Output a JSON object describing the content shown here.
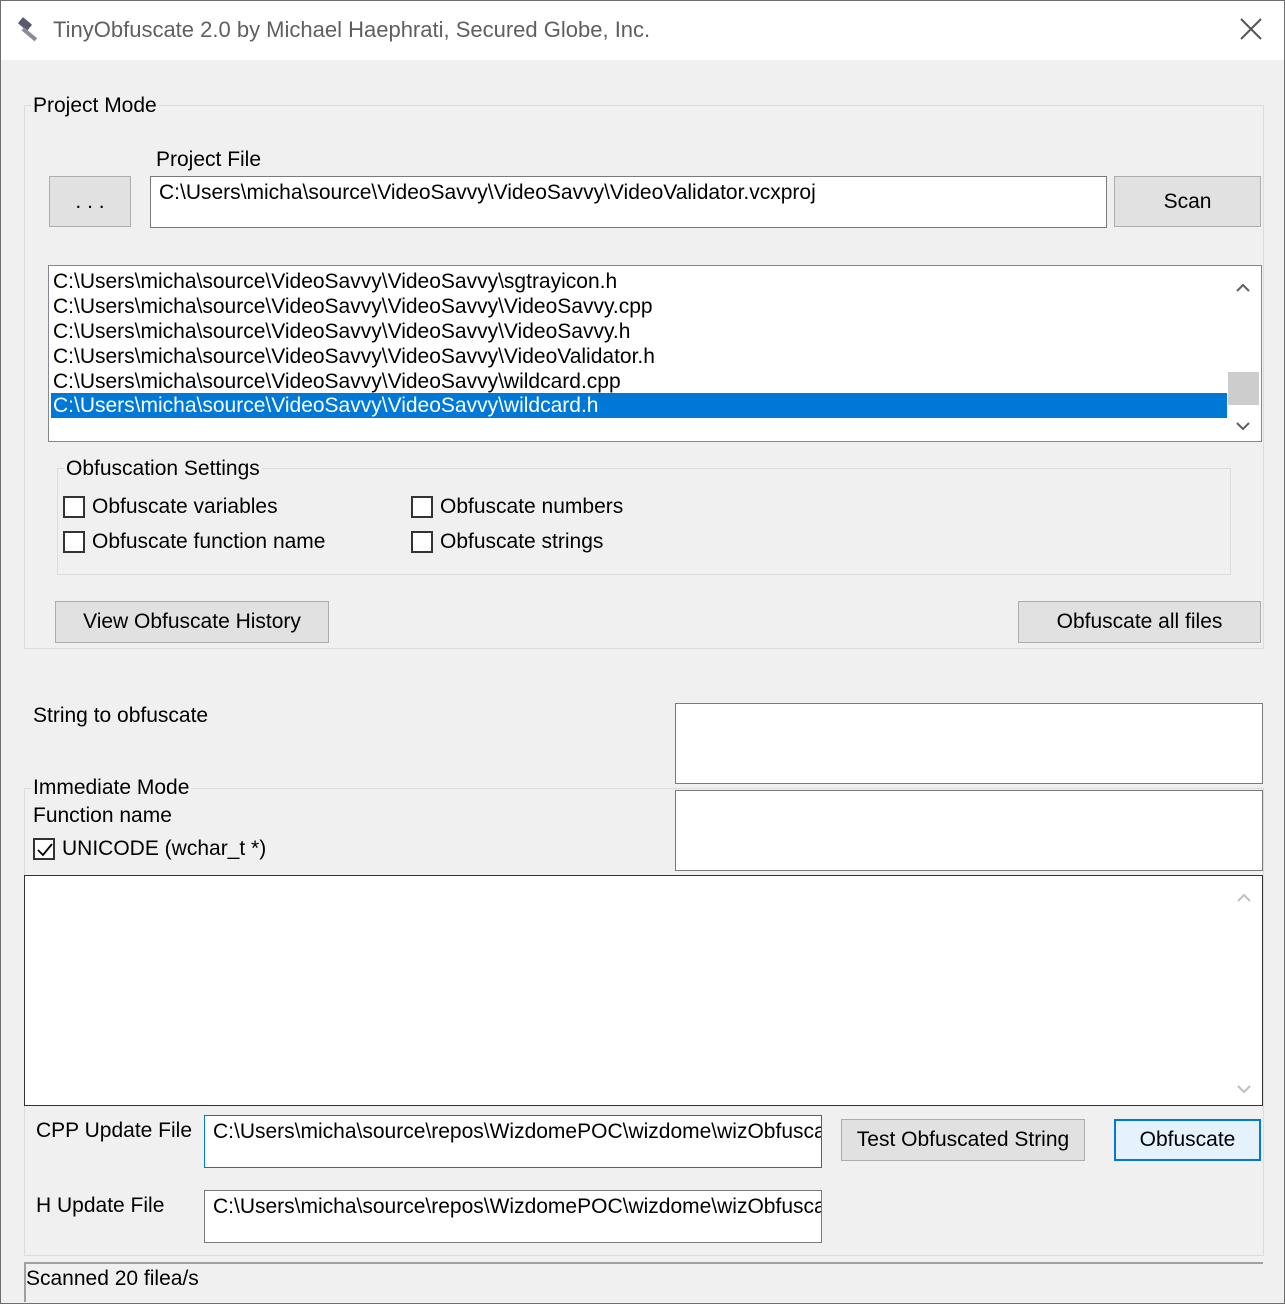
{
  "window": {
    "title": "TinyObfuscate 2.0 by Michael Haephrati, Secured Globe, Inc."
  },
  "project_mode": {
    "group_label": "Project  Mode",
    "project_file_label": "Project File",
    "browse_label": ". . .",
    "project_file_value": "C:\\Users\\micha\\source\\VideoSavvy\\VideoSavvy\\VideoValidator.vcxproj",
    "scan_label": "Scan",
    "files": [
      "C:\\Users\\micha\\source\\VideoSavvy\\VideoSavvy\\sgtrayicon.h",
      "C:\\Users\\micha\\source\\VideoSavvy\\VideoSavvy\\VideoSavvy.cpp",
      "C:\\Users\\micha\\source\\VideoSavvy\\VideoSavvy\\VideoSavvy.h",
      "C:\\Users\\micha\\source\\VideoSavvy\\VideoSavvy\\VideoValidator.h",
      "C:\\Users\\micha\\source\\VideoSavvy\\VideoSavvy\\wildcard.cpp",
      "C:\\Users\\micha\\source\\VideoSavvy\\VideoSavvy\\wildcard.h"
    ],
    "selected_file": "C:\\Users\\micha\\source\\VideoSavvy\\VideoSavvy\\wildcard.h",
    "settings": {
      "group_label": "Obfuscation Settings",
      "obfuscate_variables": {
        "label": "Obfuscate variables",
        "checked": false
      },
      "obfuscate_function_name": {
        "label": "Obfuscate function name",
        "checked": false
      },
      "obfuscate_numbers": {
        "label": "Obfuscate numbers",
        "checked": false
      },
      "obfuscate_strings": {
        "label": "Obfuscate strings",
        "checked": false
      }
    },
    "view_history_label": "View Obfuscate History",
    "obfuscate_all_label": "Obfuscate all files"
  },
  "immediate_mode": {
    "string_label": "String to obfuscate",
    "string_value": "",
    "group_label": "Immediate Mode",
    "function_name_label": "Function name",
    "function_name_value": "",
    "unicode": {
      "label": "UNICODE (wchar_t *)",
      "checked": true
    },
    "output_value": "",
    "cpp_update_label": "CPP Update File",
    "cpp_update_value": "C:\\Users\\micha\\source\\repos\\WizdomePOC\\wizdome\\wizObfusca",
    "h_update_label": "H Update File",
    "h_update_value": "C:\\Users\\micha\\source\\repos\\WizdomePOC\\wizdome\\wizObfusca",
    "test_label": "Test Obfuscated String",
    "obfuscate_label": "Obfuscate"
  },
  "status": {
    "text": "Scanned 20 filea/s"
  },
  "icons": {
    "app": "hammer-icon",
    "close": "close-icon",
    "scroll_up": "chevron-up-icon",
    "scroll_down": "chevron-down-icon",
    "check": "checkmark-icon"
  },
  "colors": {
    "selection": "#0078d7",
    "face": "#f0f0f0",
    "button": "#e1e1e1"
  }
}
